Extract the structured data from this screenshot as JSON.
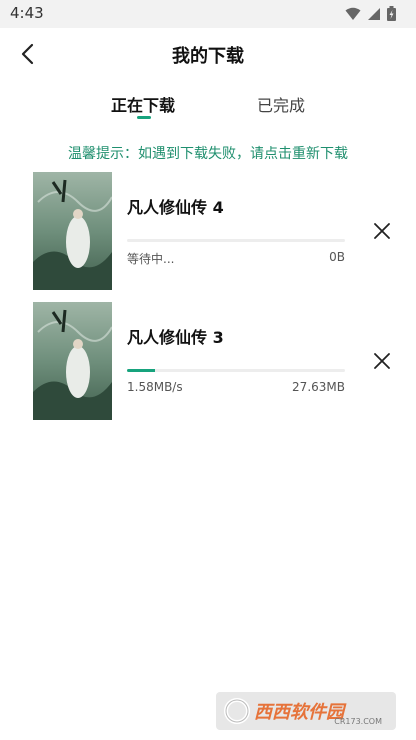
{
  "status": {
    "time": "4:43"
  },
  "header": {
    "title": "我的下载"
  },
  "tabs": [
    {
      "label": "正在下载"
    },
    {
      "label": "已完成"
    }
  ],
  "tip": "温馨提示：如遇到下载失败，请点击重新下载",
  "downloads": [
    {
      "title": "凡人修仙传 4",
      "status": "等待中...",
      "size": "0B",
      "progress": 0.0
    },
    {
      "title": "凡人修仙传 3",
      "status": "1.58MB/s",
      "size": "27.63MB",
      "progress": 0.13
    }
  ],
  "colors": {
    "accent": "#17a37d",
    "tip": "#1f8f6e"
  },
  "icons": {
    "back": "chevron-left-icon",
    "delete": "close-icon",
    "wifi": "wifi-icon",
    "signal": "signal-icon",
    "battery": "battery-icon"
  },
  "watermark": {
    "brand": "西西软件园",
    "domain": "CR173.COM"
  }
}
